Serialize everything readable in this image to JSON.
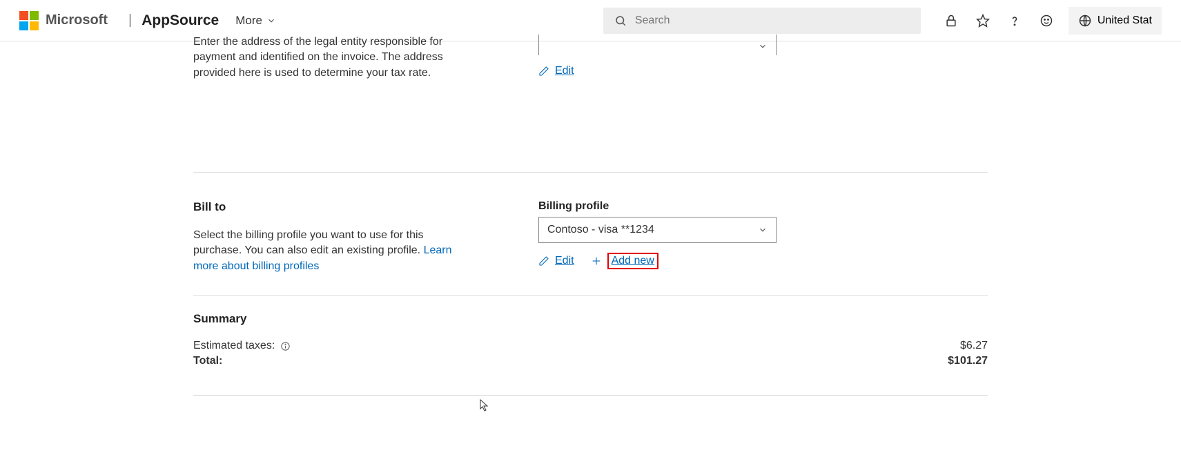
{
  "header": {
    "brand": "Microsoft",
    "app": "AppSource",
    "more": "More",
    "search_placeholder": "Search",
    "region": "United Stat"
  },
  "sold_to": {
    "desc": "Enter the address of the legal entity responsible for payment and identified on the invoice. The address provided here is used to determine your tax rate.",
    "edit": "Edit"
  },
  "bill_to": {
    "title": "Bill to",
    "desc": "Select the billing profile you want to use for this purchase. You can also edit an existing profile. ",
    "learn": "Learn more about billing profiles",
    "field_label": "Billing profile",
    "selected": "Contoso - visa **1234",
    "edit": "Edit",
    "add_new": "Add new"
  },
  "summary": {
    "title": "Summary",
    "tax_label": "Estimated taxes:",
    "tax_value": "$6.27",
    "total_label": "Total:",
    "total_value": "$101.27"
  }
}
